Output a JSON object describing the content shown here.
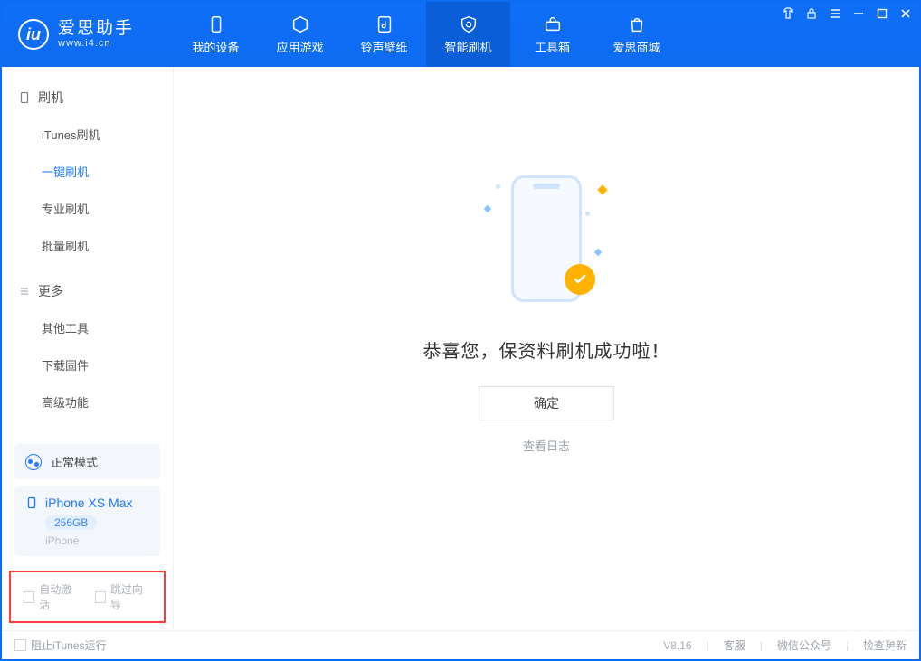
{
  "brand": {
    "name": "爱思助手",
    "url": "www.i4.cn"
  },
  "nav": {
    "device": "我的设备",
    "apps": "应用游戏",
    "ring": "铃声壁纸",
    "flash": "智能刷机",
    "tools": "工具箱",
    "store": "爱思商城"
  },
  "sidebar": {
    "group_flash": "刷机",
    "group_more": "更多",
    "items": {
      "itunes": "iTunes刷机",
      "onekey": "一键刷机",
      "pro": "专业刷机",
      "batch": "批量刷机",
      "other": "其他工具",
      "fw": "下载固件",
      "adv": "高级功能"
    }
  },
  "device_panel": {
    "mode": "正常模式",
    "name": "iPhone XS Max",
    "cap": "256GB",
    "type": "iPhone"
  },
  "side_checks": {
    "auto_activate": "自动激活",
    "skip_guide": "跳过向导"
  },
  "main": {
    "success": "恭喜您，保资料刷机成功啦！",
    "ok": "确定",
    "log": "查看日志"
  },
  "status": {
    "block_itunes": "阻止iTunes运行",
    "version": "V8.16",
    "svc": "客服",
    "wechat": "微信公众号",
    "update": "检查更新"
  }
}
